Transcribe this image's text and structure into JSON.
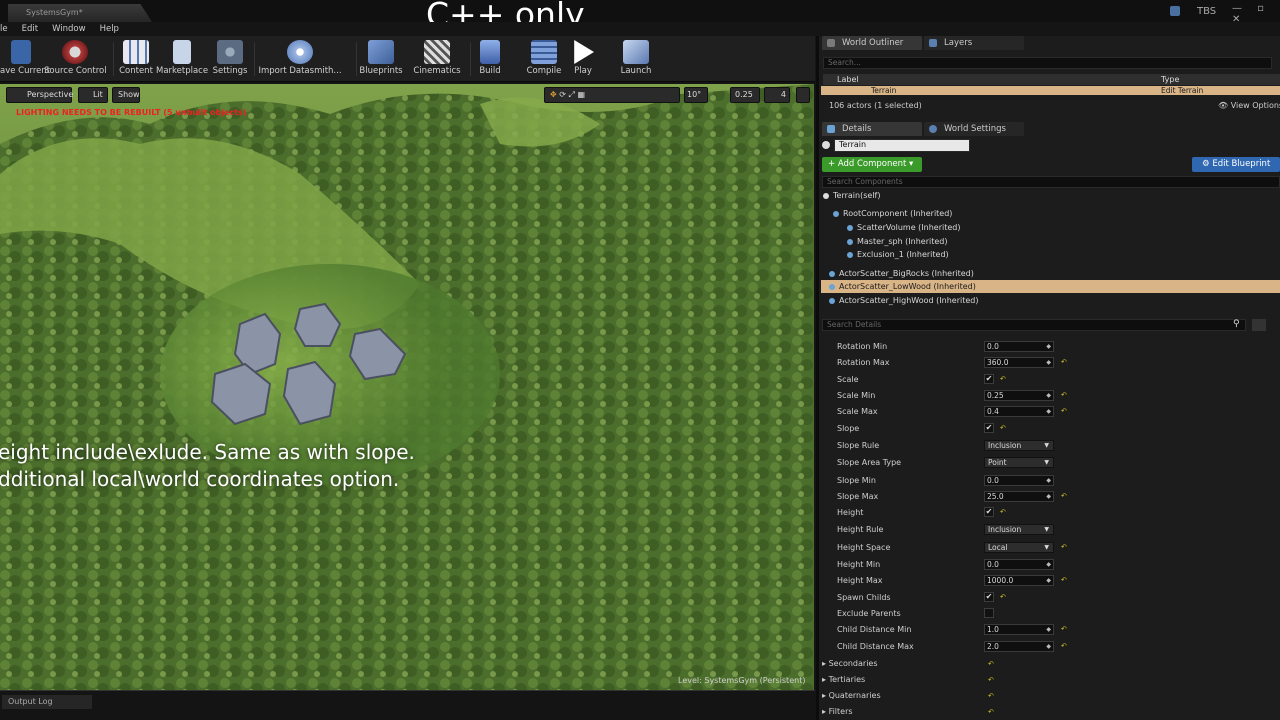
{
  "window": {
    "doc_tab": "SystemsGym*",
    "overlay_title": "C++ only",
    "right_badge": "TBS",
    "win_controls": "— ▫ ✕"
  },
  "menu": [
    "le",
    "Edit",
    "Window",
    "Help"
  ],
  "toolbar": [
    {
      "label": "ave Current",
      "icon": "save-icon",
      "color": "#3a66a8"
    },
    {
      "label": "Source Control",
      "icon": "source-control-icon",
      "color": "#b13a3a"
    },
    {
      "label": "Content",
      "icon": "content-icon",
      "color": "#d8d8e8"
    },
    {
      "label": "Marketplace",
      "icon": "marketplace-icon",
      "color": "#b8c8e0"
    },
    {
      "label": "Settings",
      "icon": "settings-icon",
      "color": "#5b6c82"
    },
    {
      "label": "Import Datasmith...",
      "icon": "datasmith-icon",
      "color": "#9db8e0"
    },
    {
      "label": "Blueprints",
      "icon": "blueprints-icon",
      "color": "#4f6fa8"
    },
    {
      "label": "Cinematics",
      "icon": "cinematics-icon",
      "color": "#8a8a8a"
    },
    {
      "label": "Build",
      "icon": "build-icon",
      "color": "#5a7fc8"
    },
    {
      "label": "Compile",
      "icon": "compile-icon",
      "color": "#4e7cc4"
    },
    {
      "label": "Play",
      "icon": "play-icon",
      "color": "#ffffff"
    },
    {
      "label": "Launch",
      "icon": "launch-icon",
      "color": "#8aa0c8"
    }
  ],
  "viewport": {
    "perspective": "Perspective",
    "lit": "Lit",
    "show": "Show",
    "snap_angle": "10°",
    "snap_scale": "0.25",
    "camera_speed": "4",
    "warning": "LIGHTING NEEDS TO BE REBUILT (5 unbuilt objects)",
    "caption_line1": "eight include\\exlude. Same as with slope.",
    "caption_line2": "dditional local\\world coordinates option.",
    "level_prefix": "Level: ",
    "level_name": "SystemsGym (Persistent)"
  },
  "bottom": {
    "output_log": "Output Log"
  },
  "outliner": {
    "tab": "World Outliner",
    "tab2": "Layers",
    "search_placeholder": "Search...",
    "col_label": "Label",
    "col_type": "Type",
    "row_label": "Terrain",
    "row_type": "Edit Terrain",
    "status": "106 actors (1 selected)",
    "view_options": "View Options"
  },
  "details": {
    "tab": "Details",
    "tab2": "World Settings",
    "name": "Terrain",
    "add_component": "+ Add Component ▾",
    "edit_blueprint": "Edit Blueprint",
    "search_components": "Search Components",
    "self_row": "Terrain(self)",
    "components": [
      {
        "label": "RootComponent (Inherited)",
        "selected": false
      },
      {
        "label": "ScatterVolume (Inherited)",
        "selected": false
      },
      {
        "label": "Master_sph (Inherited)",
        "selected": false
      },
      {
        "label": "Exclusion_1 (Inherited)",
        "selected": false
      },
      {
        "label": "ActorScatter_BigRocks (Inherited)",
        "selected": false
      },
      {
        "label": "ActorScatter_LowWood (Inherited)",
        "selected": true
      },
      {
        "label": "ActorScatter_HighWood (Inherited)",
        "selected": false
      }
    ],
    "search_details": "Search Details",
    "properties": [
      {
        "label": "Rotation Min",
        "type": "num",
        "value": "0.0",
        "reset": false
      },
      {
        "label": "Rotation Max",
        "type": "num",
        "value": "360.0",
        "reset": true
      },
      {
        "label": "Scale",
        "type": "check",
        "value": "✔",
        "reset": true
      },
      {
        "label": "Scale Min",
        "type": "num",
        "value": "0.25",
        "reset": true
      },
      {
        "label": "Scale Max",
        "type": "num",
        "value": "0.4",
        "reset": true
      },
      {
        "label": "Slope",
        "type": "check",
        "value": "✔",
        "reset": true
      },
      {
        "label": "Slope Rule",
        "type": "dd",
        "value": "Inclusion",
        "reset": false
      },
      {
        "label": "Slope Area Type",
        "type": "dd",
        "value": "Point",
        "reset": false
      },
      {
        "label": "Slope Min",
        "type": "num",
        "value": "0.0",
        "reset": false
      },
      {
        "label": "Slope Max",
        "type": "num",
        "value": "25.0",
        "reset": true
      },
      {
        "label": "Height",
        "type": "check",
        "value": "✔",
        "reset": true
      },
      {
        "label": "Height Rule",
        "type": "dd",
        "value": "Inclusion",
        "reset": false
      },
      {
        "label": "Height Space",
        "type": "dd",
        "value": "Local",
        "reset": true
      },
      {
        "label": "Height Min",
        "type": "num",
        "value": "0.0",
        "reset": false
      },
      {
        "label": "Height Max",
        "type": "num",
        "value": "1000.0",
        "reset": true
      },
      {
        "label": "Spawn Childs",
        "type": "check",
        "value": "✔",
        "reset": true
      },
      {
        "label": "Exclude Parents",
        "type": "check",
        "value": "",
        "reset": false
      },
      {
        "label": "Child Distance Min",
        "type": "num",
        "value": "1.0",
        "reset": true
      },
      {
        "label": "Child Distance Max",
        "type": "num",
        "value": "2.0",
        "reset": true
      }
    ],
    "categories": [
      "Secondaries",
      "Tertiaries",
      "Quaternaries",
      "Filters"
    ]
  }
}
